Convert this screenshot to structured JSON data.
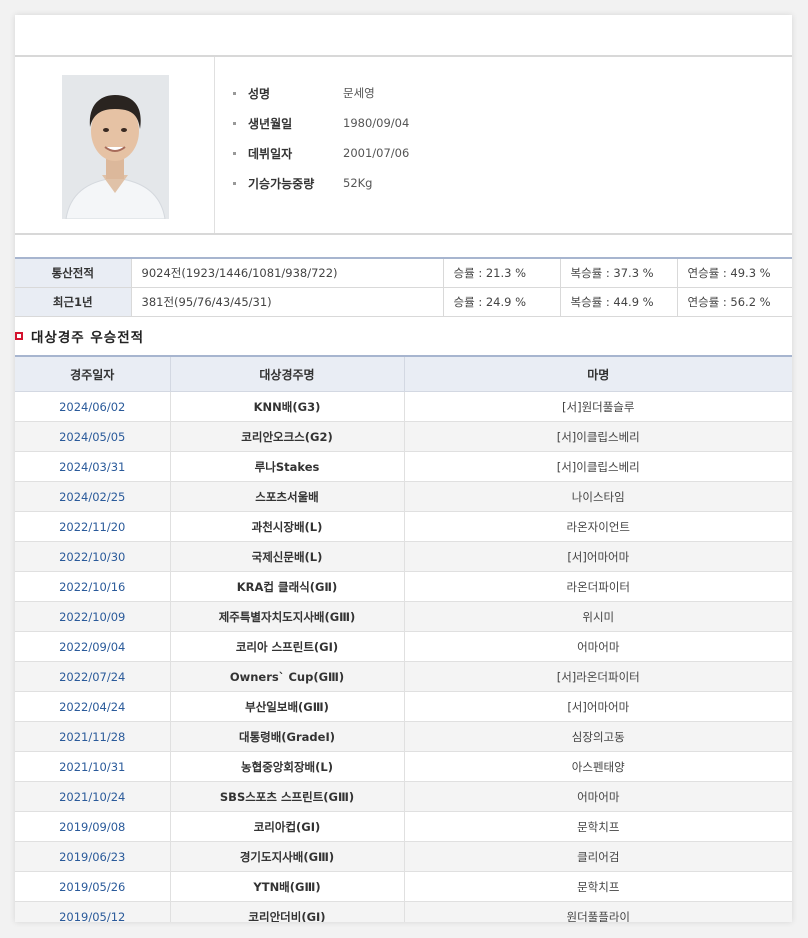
{
  "profile": {
    "fields": [
      {
        "label": "성명",
        "value": "문세영"
      },
      {
        "label": "생년월일",
        "value": "1980/09/04"
      },
      {
        "label": "데뷔일자",
        "value": "2001/07/06"
      },
      {
        "label": "기승가능중량",
        "value": "52Kg"
      }
    ]
  },
  "summary": [
    {
      "label": "통산전적",
      "record": "9024전(1923/1446/1081/938/722)",
      "win": "승률 : 21.3 %",
      "place": "복승률 : 37.3 %",
      "show": "연승률 : 49.3 %"
    },
    {
      "label": "최근1년",
      "record": "381전(95/76/43/45/31)",
      "win": "승률 : 24.9 %",
      "place": "복승률 : 44.9 %",
      "show": "연승률 : 56.2 %"
    }
  ],
  "section": {
    "title": "대상경주 우승전적"
  },
  "races": {
    "headers": [
      "경주일자",
      "대상경주명",
      "마명"
    ],
    "rows": [
      {
        "date": "2024/06/02",
        "race": "KNN배(G3)",
        "horse": "[서]원더풀슬루"
      },
      {
        "date": "2024/05/05",
        "race": "코리안오크스(G2)",
        "horse": "[서]이클립스베리"
      },
      {
        "date": "2024/03/31",
        "race": "루나Stakes",
        "horse": "[서]이클립스베리"
      },
      {
        "date": "2024/02/25",
        "race": "스포츠서울배",
        "horse": "나이스타임"
      },
      {
        "date": "2022/11/20",
        "race": "과천시장배(L)",
        "horse": "라온자이언트"
      },
      {
        "date": "2022/10/30",
        "race": "국제신문배(L)",
        "horse": "[서]어마어마"
      },
      {
        "date": "2022/10/16",
        "race": "KRA컵 클래식(GⅡ)",
        "horse": "라온더파이터"
      },
      {
        "date": "2022/10/09",
        "race": "제주특별자치도지사배(GⅢ)",
        "horse": "위시미"
      },
      {
        "date": "2022/09/04",
        "race": "코리아 스프린트(GⅠ)",
        "horse": "어마어마"
      },
      {
        "date": "2022/07/24",
        "race": "Owners` Cup(GⅢ)",
        "horse": "[서]라온더파이터"
      },
      {
        "date": "2022/04/24",
        "race": "부산일보배(GⅢ)",
        "horse": "[서]어마어마"
      },
      {
        "date": "2021/11/28",
        "race": "대통령배(GradeⅠ)",
        "horse": "심장의고동"
      },
      {
        "date": "2021/10/31",
        "race": "농협중앙회장배(L)",
        "horse": "아스펜태양"
      },
      {
        "date": "2021/10/24",
        "race": "SBS스포츠 스프린트(GⅢ)",
        "horse": "어마어마"
      },
      {
        "date": "2019/09/08",
        "race": "코리아컵(GⅠ)",
        "horse": "문학치프"
      },
      {
        "date": "2019/06/23",
        "race": "경기도지사배(GⅢ)",
        "horse": "클리어검"
      },
      {
        "date": "2019/05/26",
        "race": "YTN배(GⅢ)",
        "horse": "문학치프"
      },
      {
        "date": "2019/05/12",
        "race": "코리안더비(GⅠ)",
        "horse": "원더풀플라이"
      }
    ]
  }
}
